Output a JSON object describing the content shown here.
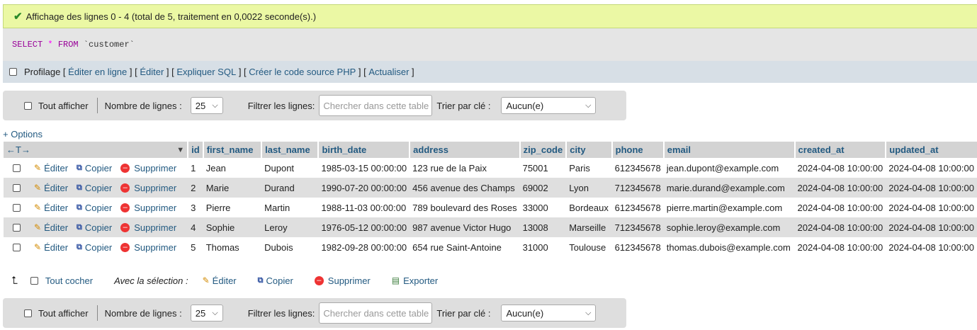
{
  "success_message": "Affichage des lignes 0 - 4 (total de 5, traitement en 0,0022 seconde(s).)",
  "sql": {
    "select": "SELECT",
    "star": "*",
    "from": "FROM",
    "table": "`customer`"
  },
  "profiling": {
    "label": "Profilage",
    "links": [
      "Éditer en ligne",
      "Éditer",
      "Expliquer SQL",
      "Créer le code source PHP",
      "Actualiser"
    ]
  },
  "nav": {
    "show_all": "Tout afficher",
    "rows_label": "Nombre de lignes :",
    "rows_value": "25",
    "filter_label": "Filtrer les lignes:",
    "filter_placeholder": "Chercher dans cette table",
    "sort_label": "Trier par clé :",
    "sort_value": "Aucun(e)"
  },
  "options_link": "+ Options",
  "columns": [
    "id",
    "first_name",
    "last_name",
    "birth_date",
    "address",
    "zip_code",
    "city",
    "phone",
    "email",
    "created_at",
    "updated_at"
  ],
  "row_actions": {
    "edit": "Éditer",
    "copy": "Copier",
    "delete": "Supprimer"
  },
  "rows": [
    [
      "1",
      "Jean",
      "Dupont",
      "1985-03-15 00:00:00",
      "123 rue de la Paix",
      "75001",
      "Paris",
      "612345678",
      "jean.dupont@example.com",
      "2024-04-08 10:00:00",
      "2024-04-08 10:00:00"
    ],
    [
      "2",
      "Marie",
      "Durand",
      "1990-07-20 00:00:00",
      "456 avenue des Champs",
      "69002",
      "Lyon",
      "712345678",
      "marie.durand@example.com",
      "2024-04-08 10:00:00",
      "2024-04-08 10:00:00"
    ],
    [
      "3",
      "Pierre",
      "Martin",
      "1988-11-03 00:00:00",
      "789 boulevard des Roses",
      "33000",
      "Bordeaux",
      "612345678",
      "pierre.martin@example.com",
      "2024-04-08 10:00:00",
      "2024-04-08 10:00:00"
    ],
    [
      "4",
      "Sophie",
      "Leroy",
      "1976-05-12 00:00:00",
      "987 avenue Victor Hugo",
      "13008",
      "Marseille",
      "712345678",
      "sophie.leroy@example.com",
      "2024-04-08 10:00:00",
      "2024-04-08 10:00:00"
    ],
    [
      "5",
      "Thomas",
      "Dubois",
      "1982-09-28 00:00:00",
      "654 rue Saint-Antoine",
      "31000",
      "Toulouse",
      "612345678",
      "thomas.dubois@example.com",
      "2024-04-08 10:00:00",
      "2024-04-08 10:00:00"
    ]
  ],
  "bulk": {
    "check_all": "Tout cocher",
    "with_selection": "Avec la sélection :",
    "edit": "Éditer",
    "copy": "Copier",
    "delete": "Supprimer",
    "export": "Exporter"
  }
}
